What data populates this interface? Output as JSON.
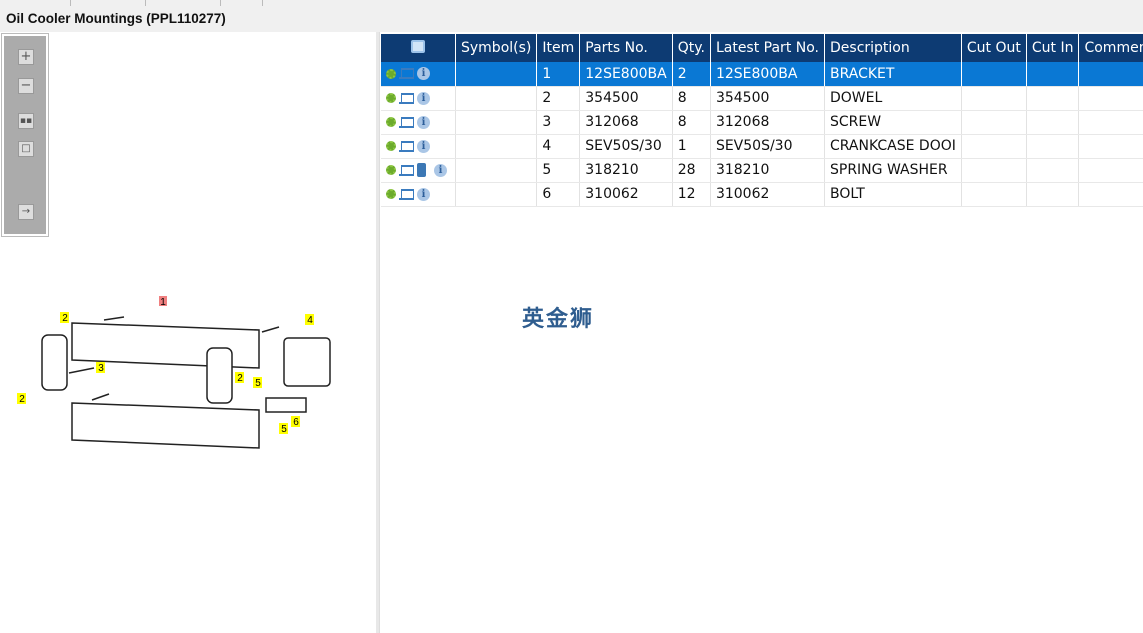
{
  "title": "Oil Cooler Mountings (PPL110277)",
  "toolbar": {
    "icons": [
      "zoom-in-icon",
      "zoom-out-icon",
      "fit-all-icon",
      "actual-size-icon",
      "export-icon"
    ]
  },
  "diagram": {
    "callouts": [
      "1",
      "2",
      "2",
      "2",
      "3",
      "4",
      "5",
      "5",
      "6"
    ],
    "highlighted_callout": "1",
    "highlight_color": "#f08080",
    "callout_color": "#ffff00"
  },
  "table": {
    "headers": [
      "",
      "Symbol(s)",
      "Item",
      "Parts No.",
      "Qty.",
      "Latest Part No.",
      "Description",
      "Cut Out",
      "Cut In",
      "Comment"
    ],
    "header_color": "#0d3b73",
    "selected_color": "#0a78d4",
    "rows": [
      {
        "item": "1",
        "parts_no": "12SE800BA",
        "qty": "2",
        "latest": "12SE800BA",
        "description": "BRACKET",
        "selected": true
      },
      {
        "item": "2",
        "parts_no": "354500",
        "qty": "8",
        "latest": "354500",
        "description": "DOWEL"
      },
      {
        "item": "3",
        "parts_no": "312068",
        "qty": "8",
        "latest": "312068",
        "description": "SCREW"
      },
      {
        "item": "4",
        "parts_no": "SEV50S/30",
        "qty": "1",
        "latest": "SEV50S/30",
        "description": "CRANKCASE DOOI"
      },
      {
        "item": "5",
        "parts_no": "318210",
        "qty": "28",
        "latest": "318210",
        "description": "SPRING WASHER",
        "book": true
      },
      {
        "item": "6",
        "parts_no": "310062",
        "qty": "12",
        "latest": "310062",
        "description": "BOLT"
      }
    ]
  },
  "watermark": "英金狮"
}
